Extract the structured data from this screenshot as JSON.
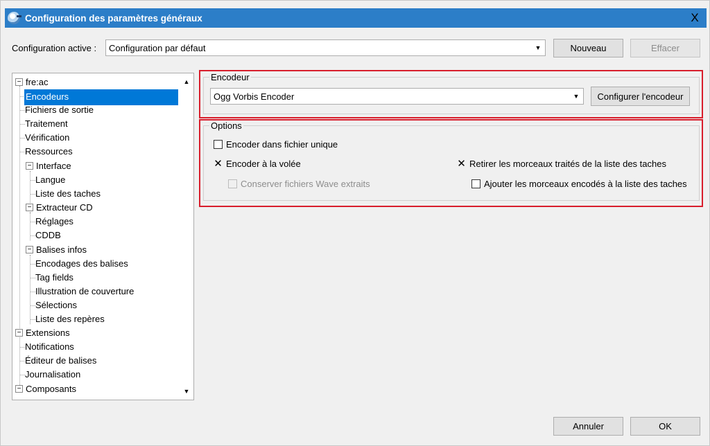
{
  "window": {
    "title": "Configuration des paramètres généraux",
    "close_glyph": "X",
    "accent_color": "#2c7ec8"
  },
  "config": {
    "label": "Configuration active :",
    "value": "Configuration par défaut",
    "new_button": "Nouveau",
    "delete_button": "Effacer"
  },
  "tree": {
    "items": [
      {
        "label": "fre:ac",
        "level": 0,
        "expander": "−"
      },
      {
        "label": "Encodeurs",
        "level": 1,
        "selected": true
      },
      {
        "label": "Fichiers de sortie",
        "level": 1
      },
      {
        "label": "Traitement",
        "level": 1
      },
      {
        "label": "Vérification",
        "level": 1
      },
      {
        "label": "Ressources",
        "level": 1
      },
      {
        "label": "Interface",
        "level": 1,
        "expander": "−"
      },
      {
        "label": "Langue",
        "level": 2
      },
      {
        "label": "Liste des taches",
        "level": 2
      },
      {
        "label": "Extracteur CD",
        "level": 1,
        "expander": "−"
      },
      {
        "label": "Réglages",
        "level": 2
      },
      {
        "label": "CDDB",
        "level": 2
      },
      {
        "label": "Balises infos",
        "level": 1,
        "expander": "−"
      },
      {
        "label": "Encodages des balises",
        "level": 2
      },
      {
        "label": "Tag fields",
        "level": 2
      },
      {
        "label": "Illustration de couverture",
        "level": 2
      },
      {
        "label": "Sélections",
        "level": 2
      },
      {
        "label": "Liste des repères",
        "level": 2
      },
      {
        "label": "Extensions",
        "level": 0,
        "expander": "−"
      },
      {
        "label": "Notifications",
        "level": 1
      },
      {
        "label": "Éditeur de balises",
        "level": 1
      },
      {
        "label": "Journalisation",
        "level": 1
      },
      {
        "label": "Composants",
        "level": 0,
        "expander": "−"
      }
    ]
  },
  "encoder": {
    "group_title": "Encodeur",
    "selected": "Ogg Vorbis Encoder",
    "configure_button": "Configurer l'encodeur"
  },
  "options": {
    "group_title": "Options",
    "single_file": {
      "label": "Encoder dans fichier unique",
      "checked": false
    },
    "on_the_fly": {
      "label": "Encoder à la volée",
      "checked": true
    },
    "keep_wave": {
      "label": "Conserver fichiers Wave extraits",
      "checked": false,
      "disabled": true
    },
    "remove_tracks": {
      "label": "Retirer les morceaux traités de la liste des taches",
      "checked": true
    },
    "add_encoded": {
      "label": "Ajouter les morceaux encodés à la liste des taches",
      "checked": false
    }
  },
  "footer": {
    "cancel_button": "Annuler",
    "ok_button": "OK"
  },
  "highlight_color": "#d81e2c",
  "selection_color": "#0078d7"
}
